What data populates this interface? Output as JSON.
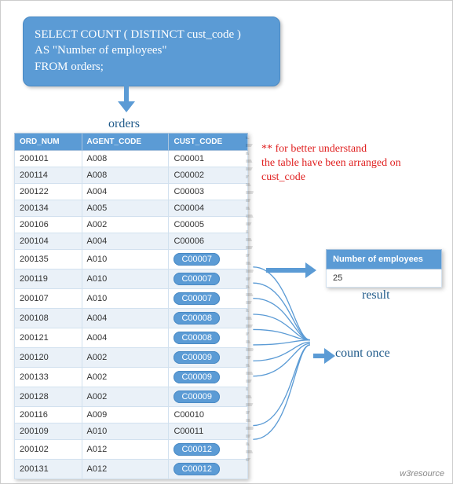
{
  "sql": {
    "line1": "SELECT COUNT ( DISTINCT cust_code )",
    "line2": "AS \"Number of employees\"",
    "line3": "FROM orders;"
  },
  "labels": {
    "orders": "orders",
    "result": "result",
    "count_once": "count once"
  },
  "note": {
    "line1": "** for better understand",
    "line2": "the table have been arranged on",
    "line3": "cust_code"
  },
  "orders_table": {
    "headers": [
      "ORD_NUM",
      "AGENT_CODE",
      "CUST_CODE"
    ],
    "rows": [
      {
        "ord_num": "200101",
        "agent_code": "A008",
        "cust_code": "C00001",
        "hl": false
      },
      {
        "ord_num": "200114",
        "agent_code": "A008",
        "cust_code": "C00002",
        "hl": false
      },
      {
        "ord_num": "200122",
        "agent_code": "A004",
        "cust_code": "C00003",
        "hl": false
      },
      {
        "ord_num": "200134",
        "agent_code": "A005",
        "cust_code": "C00004",
        "hl": false
      },
      {
        "ord_num": "200106",
        "agent_code": "A002",
        "cust_code": "C00005",
        "hl": false
      },
      {
        "ord_num": "200104",
        "agent_code": "A004",
        "cust_code": "C00006",
        "hl": false
      },
      {
        "ord_num": "200135",
        "agent_code": "A010",
        "cust_code": "C00007",
        "hl": true
      },
      {
        "ord_num": "200119",
        "agent_code": "A010",
        "cust_code": "C00007",
        "hl": true
      },
      {
        "ord_num": "200107",
        "agent_code": "A010",
        "cust_code": "C00007",
        "hl": true
      },
      {
        "ord_num": "200108",
        "agent_code": "A004",
        "cust_code": "C00008",
        "hl": true
      },
      {
        "ord_num": "200121",
        "agent_code": "A004",
        "cust_code": "C00008",
        "hl": true
      },
      {
        "ord_num": "200120",
        "agent_code": "A002",
        "cust_code": "C00009",
        "hl": true
      },
      {
        "ord_num": "200133",
        "agent_code": "A002",
        "cust_code": "C00009",
        "hl": true
      },
      {
        "ord_num": "200128",
        "agent_code": "A002",
        "cust_code": "C00009",
        "hl": true
      },
      {
        "ord_num": "200116",
        "agent_code": "A009",
        "cust_code": "C00010",
        "hl": false
      },
      {
        "ord_num": "200109",
        "agent_code": "A010",
        "cust_code": "C00011",
        "hl": false
      },
      {
        "ord_num": "200102",
        "agent_code": "A012",
        "cust_code": "C00012",
        "hl": true
      },
      {
        "ord_num": "200131",
        "agent_code": "A012",
        "cust_code": "C00012",
        "hl": true
      }
    ]
  },
  "result_table": {
    "header": "Number of employees",
    "value": "25"
  },
  "footer": "w3resource"
}
